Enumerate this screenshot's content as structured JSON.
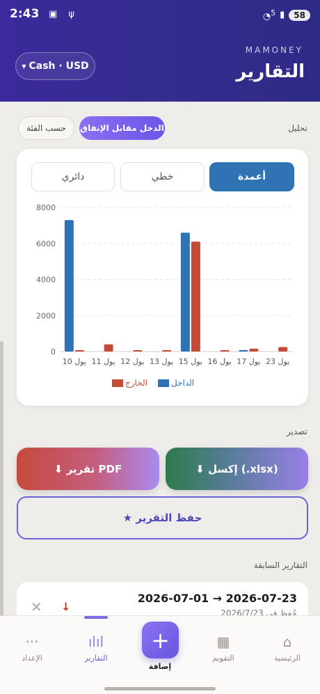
{
  "status": {
    "time": "2:43",
    "battery": "58",
    "wifi_badge": "5"
  },
  "header": {
    "brand": "MAMONEY",
    "title": "التقارير",
    "currency": "Cash · USD"
  },
  "analysis": {
    "label": "تحليل",
    "tabs": [
      {
        "label": "الدخل مقابل الإنفاق",
        "active": true
      },
      {
        "label": "حسب الفئة",
        "active": false
      }
    ]
  },
  "chart_type_tabs": [
    {
      "label": "أعمدة",
      "active": true
    },
    {
      "label": "خطي",
      "active": false
    },
    {
      "label": "دائري",
      "active": false
    }
  ],
  "chart_data": {
    "type": "bar",
    "categories": [
      "10 يول",
      "11 يول",
      "12 يول",
      "13 يول",
      "15 يول",
      "16 يول",
      "17 يول",
      "23 يول"
    ],
    "series": [
      {
        "name": "الداخل",
        "color": "#2f73b5",
        "values": [
          7300,
          0,
          0,
          0,
          6600,
          0,
          80,
          0
        ]
      },
      {
        "name": "الخارج",
        "color": "#c44b35",
        "values": [
          50,
          400,
          30,
          30,
          6100,
          30,
          160,
          250
        ]
      }
    ],
    "yticks": [
      "0",
      "2000",
      "4000",
      "6000",
      "8000"
    ],
    "ylim": [
      0,
      8000
    ],
    "grid": true,
    "legend_position": "bottom"
  },
  "export": {
    "label": "تصدير",
    "excel": "⬇ إكسل (.xlsx)",
    "pdf": "⬇ تقرير PDF",
    "save": "★ حفظ التقرير"
  },
  "previous": {
    "label": "التقارير السابقة",
    "items": [
      {
        "range": "2026-07-01 → 2026-07-23",
        "saved": "حُفظ في 2026/7/23"
      }
    ]
  },
  "nav": {
    "items": [
      {
        "label": "الرئيسية",
        "icon": "home-icon"
      },
      {
        "label": "التقويم",
        "icon": "calendar-icon"
      },
      {
        "label": "إضافة",
        "icon": "plus-icon"
      },
      {
        "label": "التقارير",
        "icon": "bar-chart-icon"
      },
      {
        "label": "الإعداد",
        "icon": "more-icon"
      }
    ]
  }
}
